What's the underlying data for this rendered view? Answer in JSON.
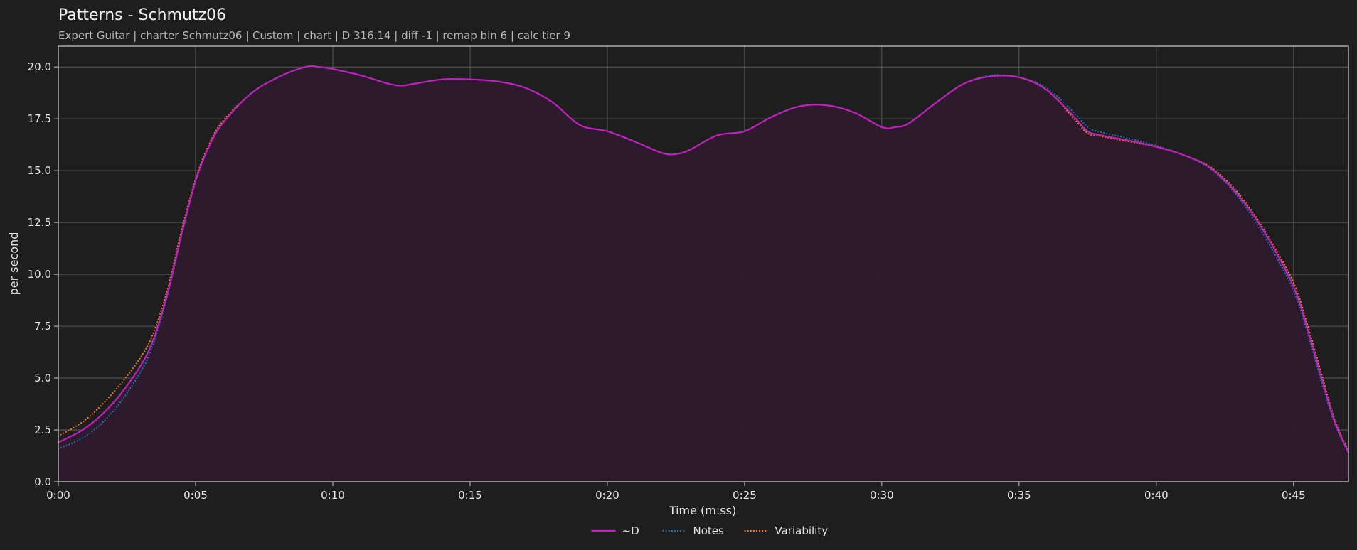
{
  "chart_data": {
    "type": "line",
    "title": "Patterns - Schmutz06",
    "subtitle": "Expert Guitar  |  charter Schmutz06  |  Custom  |  chart  |  D 316.14  |  diff -1  |  remap bin 6  |  calc tier 9",
    "xlabel": "Time (m:ss)",
    "ylabel": "per second",
    "xlim": [
      0,
      47
    ],
    "ylim": [
      0,
      21
    ],
    "x_ticks": [
      {
        "value": 0,
        "label": "0:00"
      },
      {
        "value": 5,
        "label": "0:05"
      },
      {
        "value": 10,
        "label": "0:10"
      },
      {
        "value": 15,
        "label": "0:15"
      },
      {
        "value": 20,
        "label": "0:20"
      },
      {
        "value": 25,
        "label": "0:25"
      },
      {
        "value": 30,
        "label": "0:30"
      },
      {
        "value": 35,
        "label": "0:35"
      },
      {
        "value": 40,
        "label": "0:40"
      },
      {
        "value": 45,
        "label": "0:45"
      }
    ],
    "y_ticks": [
      {
        "value": 0,
        "label": "0.0"
      },
      {
        "value": 2.5,
        "label": "2.5"
      },
      {
        "value": 5,
        "label": "5.0"
      },
      {
        "value": 7.5,
        "label": "7.5"
      },
      {
        "value": 10,
        "label": "10.0"
      },
      {
        "value": 12.5,
        "label": "12.5"
      },
      {
        "value": 15,
        "label": "15.0"
      },
      {
        "value": 17.5,
        "label": "17.5"
      },
      {
        "value": 20,
        "label": "20.0"
      }
    ],
    "grid": true,
    "legend_position": "bottom-center",
    "series": [
      {
        "name": "~D",
        "color": "#c020c0",
        "style": "solid",
        "fill": "#2e1b2e",
        "points": [
          [
            0,
            1.9
          ],
          [
            1,
            2.6
          ],
          [
            2,
            3.8
          ],
          [
            3,
            5.6
          ],
          [
            3.5,
            7.0
          ],
          [
            4,
            9.2
          ],
          [
            4.5,
            12.0
          ],
          [
            5,
            14.5
          ],
          [
            5.5,
            16.2
          ],
          [
            6,
            17.3
          ],
          [
            7,
            18.7
          ],
          [
            8,
            19.5
          ],
          [
            9,
            20.0
          ],
          [
            9.5,
            20.0
          ],
          [
            10,
            19.9
          ],
          [
            11,
            19.6
          ],
          [
            12,
            19.2
          ],
          [
            12.5,
            19.1
          ],
          [
            13,
            19.2
          ],
          [
            14,
            19.4
          ],
          [
            15,
            19.4
          ],
          [
            16,
            19.3
          ],
          [
            17,
            19.0
          ],
          [
            18,
            18.3
          ],
          [
            19,
            17.2
          ],
          [
            20,
            16.9
          ],
          [
            21,
            16.4
          ],
          [
            22,
            15.85
          ],
          [
            22.5,
            15.8
          ],
          [
            23,
            16.0
          ],
          [
            24,
            16.7
          ],
          [
            25,
            16.9
          ],
          [
            26,
            17.6
          ],
          [
            27,
            18.1
          ],
          [
            28,
            18.15
          ],
          [
            29,
            17.8
          ],
          [
            30,
            17.1
          ],
          [
            30.5,
            17.1
          ],
          [
            31,
            17.3
          ],
          [
            32,
            18.3
          ],
          [
            33,
            19.2
          ],
          [
            34,
            19.55
          ],
          [
            35,
            19.5
          ],
          [
            36,
            18.9
          ],
          [
            37,
            17.6
          ],
          [
            37.5,
            16.9
          ],
          [
            38,
            16.7
          ],
          [
            39,
            16.45
          ],
          [
            40,
            16.15
          ],
          [
            41,
            15.75
          ],
          [
            42,
            15.1
          ],
          [
            43,
            13.8
          ],
          [
            44,
            11.9
          ],
          [
            45,
            9.4
          ],
          [
            45.5,
            7.4
          ],
          [
            46,
            5.1
          ],
          [
            46.5,
            2.9
          ],
          [
            47,
            1.4
          ]
        ]
      },
      {
        "name": "Notes",
        "color": "#1f77b4",
        "style": "dotted",
        "points": [
          [
            0,
            1.6
          ],
          [
            1,
            2.2
          ],
          [
            2,
            3.4
          ],
          [
            3,
            5.3
          ],
          [
            3.5,
            6.8
          ],
          [
            4,
            9.1
          ],
          [
            4.5,
            11.9
          ],
          [
            5,
            14.5
          ],
          [
            5.5,
            16.2
          ],
          [
            6,
            17.3
          ],
          [
            7,
            18.7
          ],
          [
            8,
            19.5
          ],
          [
            9,
            20.0
          ],
          [
            9.5,
            20.0
          ],
          [
            10,
            19.9
          ],
          [
            11,
            19.6
          ],
          [
            12,
            19.2
          ],
          [
            12.5,
            19.1
          ],
          [
            13,
            19.2
          ],
          [
            14,
            19.4
          ],
          [
            15,
            19.4
          ],
          [
            16,
            19.3
          ],
          [
            17,
            19.0
          ],
          [
            18,
            18.3
          ],
          [
            19,
            17.2
          ],
          [
            20,
            16.9
          ],
          [
            21,
            16.4
          ],
          [
            22,
            15.85
          ],
          [
            22.5,
            15.8
          ],
          [
            23,
            16.0
          ],
          [
            24,
            16.7
          ],
          [
            25,
            16.9
          ],
          [
            26,
            17.6
          ],
          [
            27,
            18.1
          ],
          [
            28,
            18.15
          ],
          [
            29,
            17.8
          ],
          [
            30,
            17.1
          ],
          [
            30.5,
            17.1
          ],
          [
            31,
            17.3
          ],
          [
            32,
            18.3
          ],
          [
            33,
            19.2
          ],
          [
            34,
            19.6
          ],
          [
            35,
            19.5
          ],
          [
            36,
            19.0
          ],
          [
            37,
            17.8
          ],
          [
            37.5,
            17.1
          ],
          [
            38,
            16.85
          ],
          [
            39,
            16.55
          ],
          [
            40,
            16.2
          ],
          [
            41,
            15.75
          ],
          [
            42,
            15.05
          ],
          [
            43,
            13.7
          ],
          [
            44,
            11.7
          ],
          [
            45,
            9.2
          ],
          [
            45.5,
            7.2
          ],
          [
            46,
            4.9
          ],
          [
            46.5,
            2.8
          ],
          [
            47,
            1.4
          ]
        ]
      },
      {
        "name": "Variability",
        "color": "#ff7f0e",
        "style": "dotted",
        "points": [
          [
            0,
            2.2
          ],
          [
            1,
            3.0
          ],
          [
            2,
            4.3
          ],
          [
            3,
            6.0
          ],
          [
            3.5,
            7.3
          ],
          [
            4,
            9.4
          ],
          [
            4.5,
            12.2
          ],
          [
            5,
            14.6
          ],
          [
            5.5,
            16.3
          ],
          [
            6,
            17.4
          ],
          [
            7,
            18.7
          ],
          [
            8,
            19.5
          ],
          [
            9,
            20.0
          ],
          [
            9.5,
            20.0
          ],
          [
            10,
            19.9
          ],
          [
            11,
            19.6
          ],
          [
            12,
            19.2
          ],
          [
            12.5,
            19.1
          ],
          [
            13,
            19.2
          ],
          [
            14,
            19.4
          ],
          [
            15,
            19.4
          ],
          [
            16,
            19.3
          ],
          [
            17,
            19.0
          ],
          [
            18,
            18.3
          ],
          [
            19,
            17.2
          ],
          [
            20,
            16.9
          ],
          [
            21,
            16.4
          ],
          [
            22,
            15.85
          ],
          [
            22.5,
            15.8
          ],
          [
            23,
            16.0
          ],
          [
            24,
            16.7
          ],
          [
            25,
            16.9
          ],
          [
            26,
            17.6
          ],
          [
            27,
            18.1
          ],
          [
            28,
            18.15
          ],
          [
            29,
            17.8
          ],
          [
            30,
            17.1
          ],
          [
            30.5,
            17.1
          ],
          [
            31,
            17.3
          ],
          [
            32,
            18.3
          ],
          [
            33,
            19.2
          ],
          [
            34,
            19.55
          ],
          [
            35,
            19.5
          ],
          [
            36,
            18.9
          ],
          [
            37,
            17.5
          ],
          [
            37.5,
            16.8
          ],
          [
            38,
            16.65
          ],
          [
            39,
            16.4
          ],
          [
            40,
            16.15
          ],
          [
            41,
            15.75
          ],
          [
            42,
            15.15
          ],
          [
            43,
            13.9
          ],
          [
            44,
            12.0
          ],
          [
            45,
            9.6
          ],
          [
            45.5,
            7.6
          ],
          [
            46,
            5.3
          ],
          [
            46.5,
            3.0
          ],
          [
            47,
            1.5
          ]
        ]
      }
    ]
  }
}
